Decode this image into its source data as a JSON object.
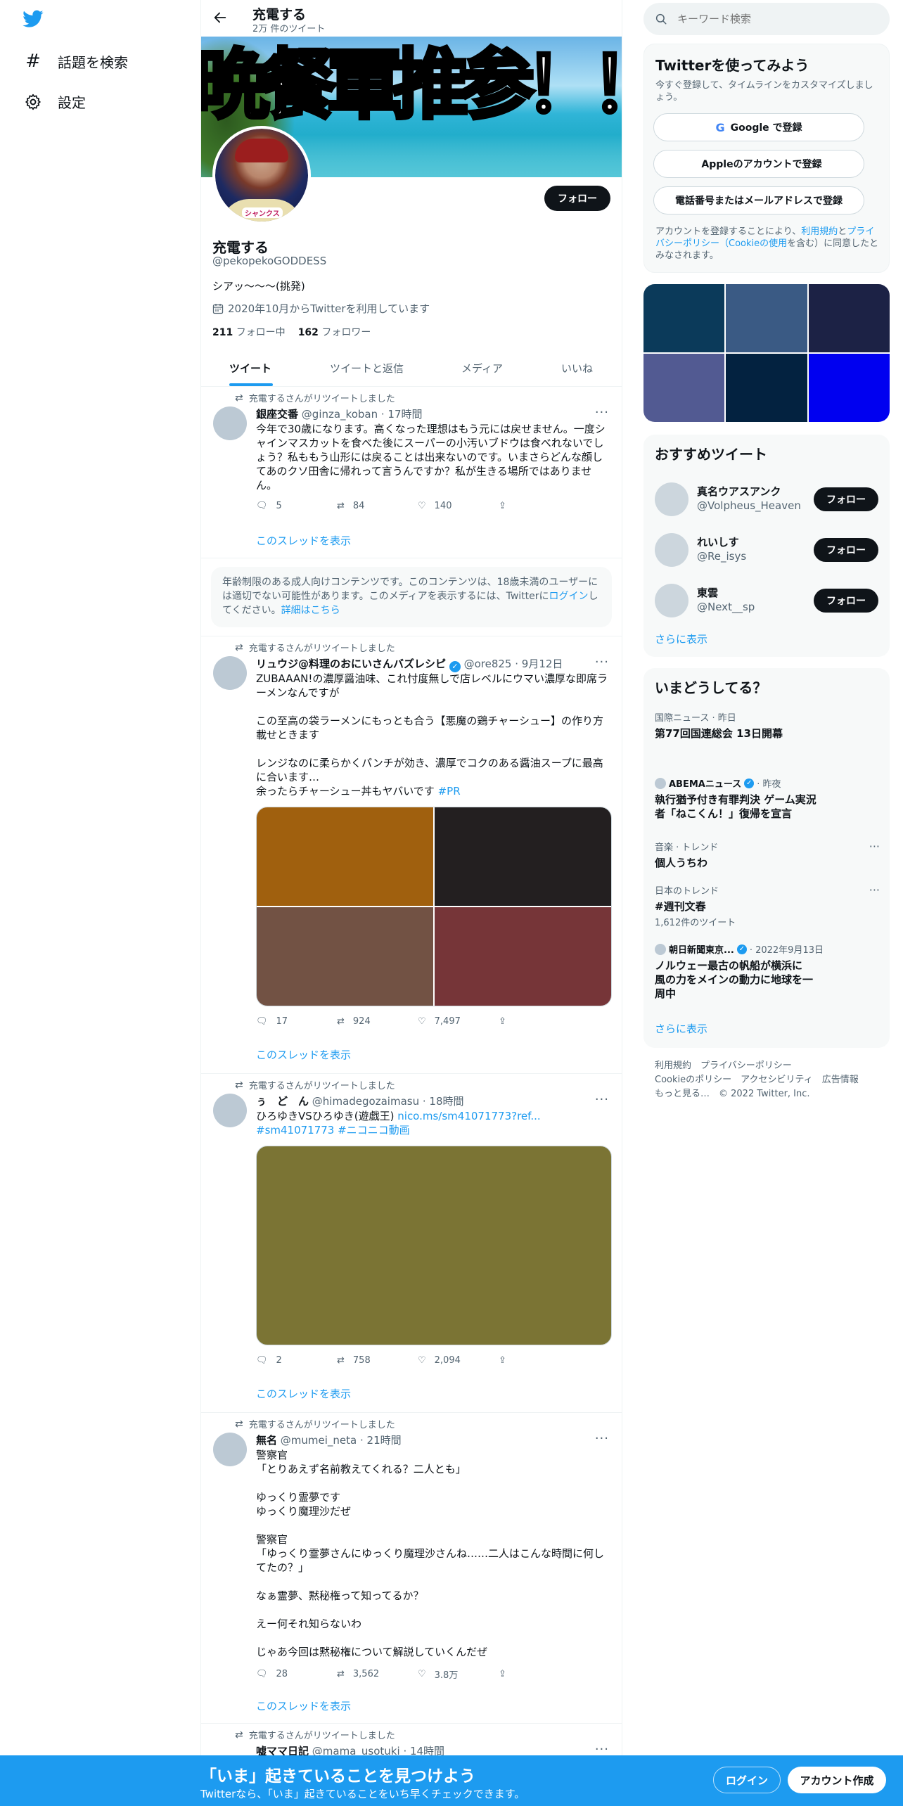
{
  "nav": {
    "explore_label": "話題を検索",
    "settings_label": "設定"
  },
  "header": {
    "name": "充電する",
    "tweet_count": "2万 件のツイート"
  },
  "banner": {
    "text": "晩餐軍推参！！！！！"
  },
  "avatar_caption": "シャンクス",
  "profile": {
    "follow_label": "フォロー",
    "name": "充電する",
    "handle": "@pekopekoGODDESS",
    "bio": "シアッ〜〜〜(挑発)",
    "joined": "2020年10月からTwitterを利用しています",
    "following_count": "211",
    "following_label": "フォロー中",
    "followers_count": "162",
    "followers_label": "フォロワー"
  },
  "tabs": [
    "ツイート",
    "ツイートと返信",
    "メディア",
    "いいね"
  ],
  "retweet_label": "充電するさんがリツイートしました",
  "thread_label": "このスレッドを表示",
  "tweets": [
    {
      "name": "銀座交番",
      "handle": "@ginza_koban",
      "time": "· 17時間",
      "text": "今年で30歳になります。高くなった理想はもう元には戻せません。一度シャインマスカットを食べた後にスーパーの小汚いブドウは食べれないでしょう？私ももう山形には戻ることは出来ないのです。いまさらどんな顔してあのクソ田舎に帰れって言うんですか？私が生きる場所ではありません。",
      "replies": "5",
      "retweets": "84",
      "likes": "140"
    },
    {
      "name": "リュウジ@料理のおにいさんバズレシピ",
      "handle": "@ore825",
      "time": "· 9月12日",
      "text": "ZUBAAAN!の濃厚醤油味、これ忖度無しで店レベルにウマい濃厚な即席ラーメンなんですが\n\nこの至高の袋ラーメンにもっとも合う【悪魔の鶏チャーシュー】の作り方載せときます\n\nレンジなのに柔らかくパンチが効き、濃厚でコクのある醤油スープに最高に合います…\n余ったらチャーシュー丼もヤバいです ",
      "hashtag": "#PR",
      "replies": "17",
      "retweets": "924",
      "likes": "7,497"
    },
    {
      "name": "ぅ　ど　ん",
      "handle": "@himadegozaimasu",
      "time": "· 18時間",
      "text": "ひろゆきVSひろゆき(遊戯王) ",
      "link": "nico.ms/sm41071773?ref... #sm41071773 #ニコニコ動画",
      "replies": "2",
      "retweets": "758",
      "likes": "2,094"
    },
    {
      "name": "無名",
      "handle": "@mumei_neta",
      "time": "· 21時間",
      "text": "警察官\n「とりあえず名前教えてくれる？二人とも」\n\nゆっくり霊夢です\nゆっくり魔理沙だぜ\n\n警察官\n「ゆっくり霊夢さんにゆっくり魔理沙さんね……二人はこんな時間に何してたの？」\n\nなぁ霊夢、黙秘権って知ってるか？\n\nえー何それ知らないわ\n\nじゃあ今回は黙秘権について解説していくんだぜ",
      "replies": "28",
      "retweets": "3,562",
      "likes": "3.8万"
    },
    {
      "name": "嘘ママ日記",
      "handle": "@mama_usotuki",
      "time": "· 14時間"
    }
  ],
  "age_notice": {
    "text": "年齢制限のある成人向けコンテンツです。このコンテンツは、18歳未満のユーザーには適切でない可能性があります。このメディアを表示するには、Twitterに",
    "login_link": "ログイン",
    "mid": "してください。",
    "details_link": "詳細はこちら"
  },
  "search": {
    "placeholder": "キーワード検索"
  },
  "signup": {
    "title": "Twitterを使ってみよう",
    "subtitle": "今すぐ登録して、タイムラインをカスタマイズしましょう。",
    "google_label": "Google で登録",
    "apple_label": "Appleのアカウントで登録",
    "phone_label": "電話番号またはメールアドレスで登録",
    "terms_prefix": "アカウントを登録することにより、",
    "terms_link1": "利用規約",
    "terms_and": "と",
    "terms_link2": "プライバシーポリシー（Cookieの使用",
    "terms_suffix": "を含む）に同意したとみなされます。"
  },
  "media_grid_colors": [
    "#0b3a5a",
    "#3a5a84",
    "#1c2245",
    "#525a92",
    "#032240",
    "#0000f0"
  ],
  "recommend": {
    "title": "おすすめツイート",
    "users": [
      {
        "name": "真名ウアスアンク",
        "handle": "@Volpheus_Heaven",
        "follow": "フォロー"
      },
      {
        "name": "れいしす",
        "handle": "@Re_isys",
        "follow": "フォロー"
      },
      {
        "name": "東雲",
        "handle": "@Next__sp",
        "follow": "フォロー"
      }
    ],
    "show_more": "さらに表示"
  },
  "trends": {
    "title": "いまどうしてる？",
    "items": [
      {
        "cat": "国際ニュース · 昨日",
        "title": "第77回国連総会 13日開幕"
      },
      {
        "source": "ABEMAニュース",
        "when": "· 昨夜",
        "title": "執行猶予付き有罪判決 ゲーム実況者「ねこくん！」復帰を宣言"
      },
      {
        "cat": "音楽 · トレンド",
        "title": "個人うちわ"
      },
      {
        "cat": "日本のトレンド",
        "title": "#週刊文春",
        "count": "1,612件のツイート"
      },
      {
        "source": "朝日新聞東京...",
        "when": "· 2022年9月13日",
        "title": "ノルウェー最古の帆船が横浜に 風の力をメインの動力に地球を一周中"
      }
    ],
    "show_more": "さらに表示"
  },
  "footer": {
    "line1": "利用規約　プライバシーポリシー",
    "line2": "Cookieのポリシー　アクセシビリティ　広告情報",
    "line3": "もっと見る…　© 2022 Twitter, Inc."
  },
  "bottom_bar": {
    "title": "「いま」起きていることを見つけよう",
    "subtitle": "Twitterなら、「いま」起きていることをいち早くチェックできます。",
    "login": "ログイン",
    "signup": "アカウント作成"
  },
  "tweet_media_colors": [
    "#a0600e",
    "#231f20",
    "#725244",
    "#763538",
    "#7b7434"
  ],
  "colors": {
    "accent": "#1d9bf0",
    "bottom_bar": "#1d9bf0"
  }
}
